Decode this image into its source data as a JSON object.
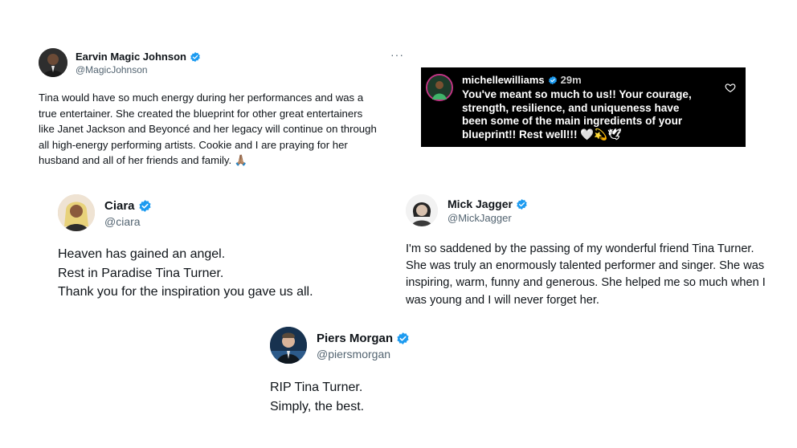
{
  "colors": {
    "verified": "#1d9bf0",
    "handle": "#536471",
    "text": "#0f1419",
    "instagram_bg": "#000000"
  },
  "magic": {
    "name": "Earvin Magic Johnson",
    "handle": "@MagicJohnson",
    "more": "···",
    "lines": [
      "Tina would have so much energy during her performances and was a",
      "true entertainer. She created the blueprint for other great entertainers",
      "like Janet Jackson and Beyoncé and her legacy will continue on through",
      "all high-energy performing artists. Cookie and I are praying for her",
      "husband and all of her friends and family. 🙏🏽"
    ]
  },
  "instagram": {
    "username": "michellewilliams",
    "time": "29m",
    "lines": [
      "You've meant so much to us!! Your courage,",
      "strength, resilience, and uniqueness have",
      "been some of the main ingredients of your",
      "blueprint!! Rest well!!! 🤍💫🕊"
    ],
    "heart_icon": "heart-outline-icon"
  },
  "ciara": {
    "name": "Ciara",
    "handle": "@ciara",
    "lines": [
      "Heaven has gained an angel.",
      "Rest in Paradise Tina Turner.",
      "Thank you for the inspiration you gave us all."
    ]
  },
  "mick": {
    "name": "Mick Jagger",
    "handle": "@MickJagger",
    "lines": [
      "I'm so saddened by the passing of my wonderful friend Tina Turner.",
      "She was truly an enormously talented performer and singer. She was",
      "inspiring, warm, funny and generous. She helped me so much when I",
      "was young and I will never forget her."
    ]
  },
  "piers": {
    "name": "Piers Morgan",
    "handle": "@piersmorgan",
    "lines": [
      "RIP Tina Turner.",
      "Simply, the best."
    ]
  }
}
